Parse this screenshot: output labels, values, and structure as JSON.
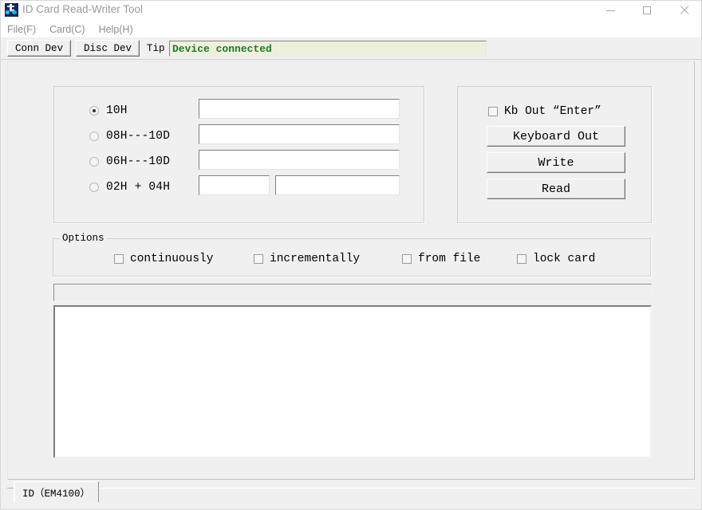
{
  "window": {
    "title": "ID Card Read-Writer Tool",
    "icon": "app-icon",
    "controls": {
      "minimize": "minimize-icon",
      "maximize": "maximize-icon",
      "close": "close-icon"
    }
  },
  "menu": {
    "items": [
      {
        "label": "File(F)"
      },
      {
        "label": "Card(C)"
      },
      {
        "label": "Help(H)"
      }
    ]
  },
  "toolbar": {
    "connect_label": "Conn Dev",
    "disconnect_label": "Disc Dev",
    "tip_label": "Tip",
    "tip_value": "Device connected",
    "tip_color": "#1a7a2a",
    "tip_background": "#eef0dc"
  },
  "mode_group": {
    "options": [
      {
        "label": "10H",
        "selected": true,
        "input_value": ""
      },
      {
        "label": "08H---10D",
        "selected": false,
        "input_value": ""
      },
      {
        "label": "06H---10D",
        "selected": false,
        "input_value": ""
      },
      {
        "label": "02H + 04H",
        "selected": false,
        "input_value": "",
        "input_value_2": ""
      }
    ]
  },
  "action_group": {
    "kb_out_enter": {
      "label": "Kb Out “Enter”",
      "checked": false
    },
    "buttons": [
      {
        "label": "Keyboard Out"
      },
      {
        "label": "Write"
      },
      {
        "label": "Read"
      }
    ]
  },
  "options_group": {
    "title": "Options",
    "checkboxes": [
      {
        "label": "continuously",
        "checked": false
      },
      {
        "label": "incrementally",
        "checked": false
      },
      {
        "label": "from file",
        "checked": false
      },
      {
        "label": "lock card",
        "checked": false
      }
    ]
  },
  "progress": {
    "percent": 0
  },
  "log": {
    "text": ""
  },
  "statusbar": {
    "tabs": [
      {
        "label": "ID（EM4100）",
        "active": true
      }
    ]
  }
}
